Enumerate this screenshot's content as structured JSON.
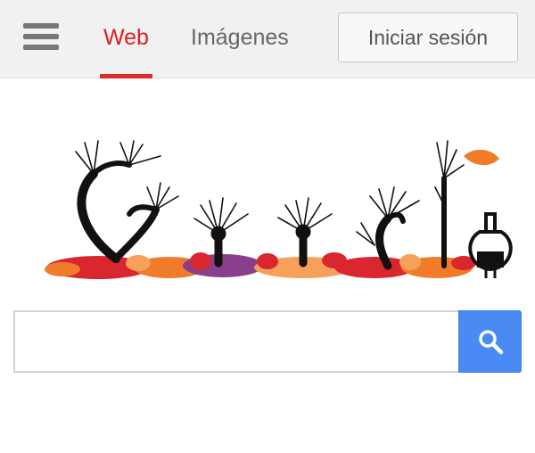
{
  "header": {
    "menu_icon": "hamburger-menu-icon",
    "tabs": [
      {
        "label": "Web",
        "active": true
      },
      {
        "label": "Imágenes",
        "active": false
      }
    ],
    "signin_label": "Iniciar sesión"
  },
  "doodle": {
    "description": "Autumn doodle of bare trees spelling the logo with red/orange/purple fallen leaves",
    "colors": {
      "trunk": "#111111",
      "leaf_red": "#d9262f",
      "leaf_orange": "#f07c2a",
      "leaf_purple": "#8a3f8c",
      "leaf_peach": "#f6a05a"
    }
  },
  "search": {
    "placeholder": "",
    "value": "",
    "button_icon": "search-icon",
    "button_color": "#4a8af4"
  },
  "colors": {
    "accent": "#dd1e1e",
    "topbar_bg": "#f1f1f1"
  }
}
